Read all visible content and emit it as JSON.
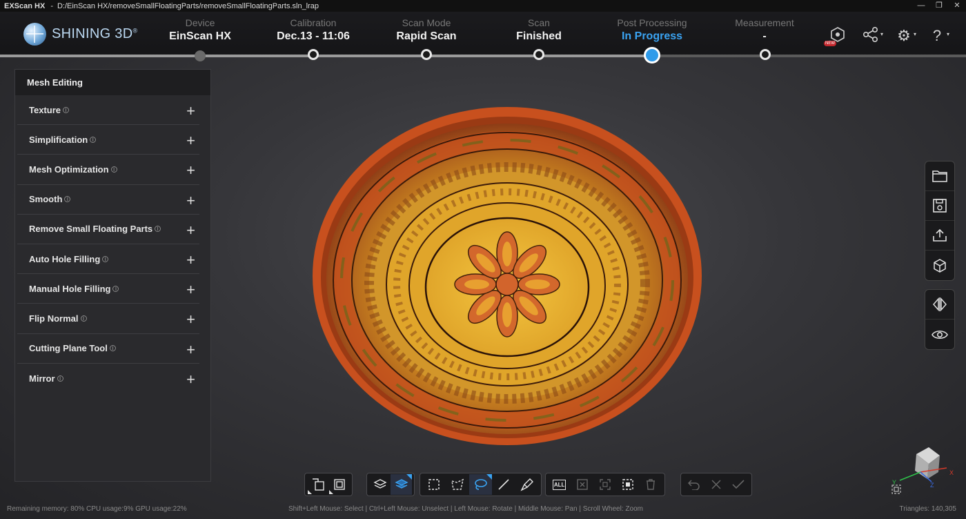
{
  "titlebar": {
    "app_name": "EXScan HX",
    "separator": "-",
    "file_path": "D:/EinScan HX/removeSmallFloatingParts/removeSmallFloatingParts.sln_lrap",
    "min": "—",
    "max": "❐",
    "close": "✕"
  },
  "logo": {
    "text": "SHINING 3D",
    "mark": "®"
  },
  "steps": [
    {
      "label": "Device",
      "value": "EinScan HX"
    },
    {
      "label": "Calibration",
      "value": "Dec.13 - 11:06"
    },
    {
      "label": "Scan Mode",
      "value": "Rapid Scan"
    },
    {
      "label": "Scan",
      "value": "Finished"
    },
    {
      "label": "Post Processing",
      "value": "In Progress"
    },
    {
      "label": "Measurement",
      "value": "-"
    }
  ],
  "header_icons": {
    "new_badge": "NEW",
    "share_glyph": "⟨",
    "settings_glyph": "⚙",
    "help_glyph": "?",
    "caret": "▾"
  },
  "panel": {
    "title": "Mesh Editing",
    "info_glyph": "i",
    "plus_glyph": "+",
    "items": [
      "Texture",
      "Simplification",
      "Mesh Optimization",
      "Smooth",
      "Remove Small Floating Parts",
      "Auto Hole Filling",
      "Manual Hole Filling",
      "Flip Normal",
      "Cutting Plane Tool",
      "Mirror"
    ]
  },
  "bottom_toolbar": {
    "select_all_label": "ALL"
  },
  "status": {
    "resources": "Remaining memory: 80% CPU usage:9%  GPU usage:22%",
    "hints": "Shift+Left Mouse: Select | Ctrl+Left Mouse: Unselect | Left Mouse: Rotate | Middle Mouse: Pan | Scroll Wheel: Zoom",
    "triangles": "Triangles: 140,305"
  },
  "axes": {
    "x": "X",
    "y": "Y",
    "z": "Z"
  },
  "colors": {
    "accent": "#3aa3f2",
    "bowl_rim": "#c8501e",
    "bowl_yellow": "#e0a52a",
    "flower": "#d2642c"
  }
}
